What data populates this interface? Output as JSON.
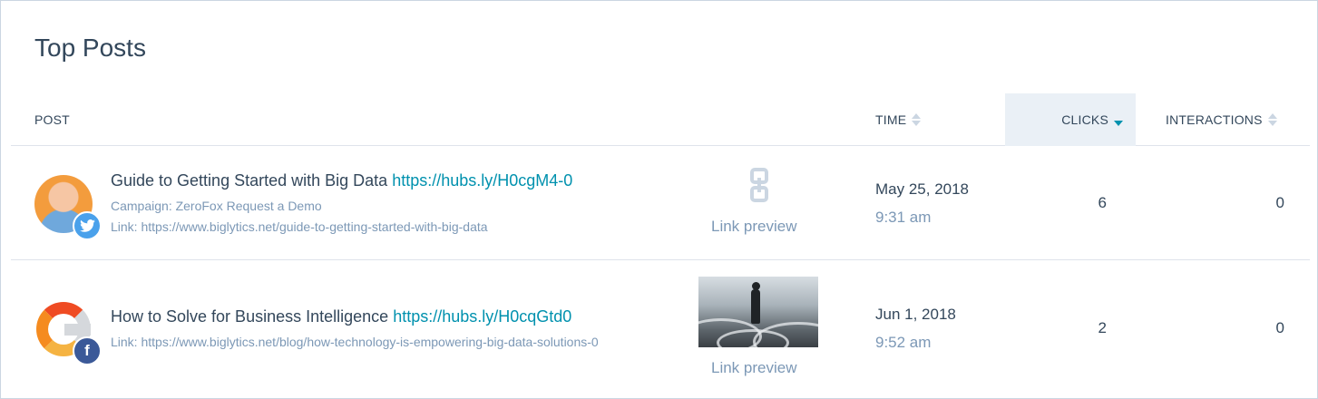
{
  "card": {
    "title": "Top Posts"
  },
  "table": {
    "columns": {
      "post": "POST",
      "time": "TIME",
      "clicks": "CLICKS",
      "interactions": "INTERACTIONS"
    },
    "sorted_column": "clicks",
    "sort_direction": "descending",
    "rows": [
      {
        "title": "Guide to Getting Started with Big Data",
        "short_url": "https://hubs.ly/H0cgM4-0",
        "campaign": "Campaign: ZeroFox Request a Demo",
        "link": "Link: https://www.biglytics.net/guide-to-getting-started-with-big-data",
        "preview_label": "Link preview",
        "preview_icon": "chain-link-icon",
        "network_icon": "twitter-icon",
        "date": "May 25, 2018",
        "time": "9:31 am",
        "clicks": "6",
        "interactions": "0"
      },
      {
        "title": "How to Solve for Business Intelligence",
        "short_url": "https://hubs.ly/H0cqGtd0",
        "link": "Link: https://www.biglytics.net/blog/how-technology-is-empowering-big-data-solutions-0",
        "preview_label": "Link preview",
        "network_icon": "facebook-icon",
        "network_glyph": "f",
        "date": "Jun 1, 2018",
        "time": "9:52 am",
        "clicks": "2",
        "interactions": "0"
      }
    ]
  },
  "colors": {
    "text": "#33475b",
    "muted": "#7c98b6",
    "link": "#0091ae",
    "sorted_header_bg": "#eaf0f6",
    "twitter": "#4aa1eb",
    "facebook": "#3b5998"
  }
}
